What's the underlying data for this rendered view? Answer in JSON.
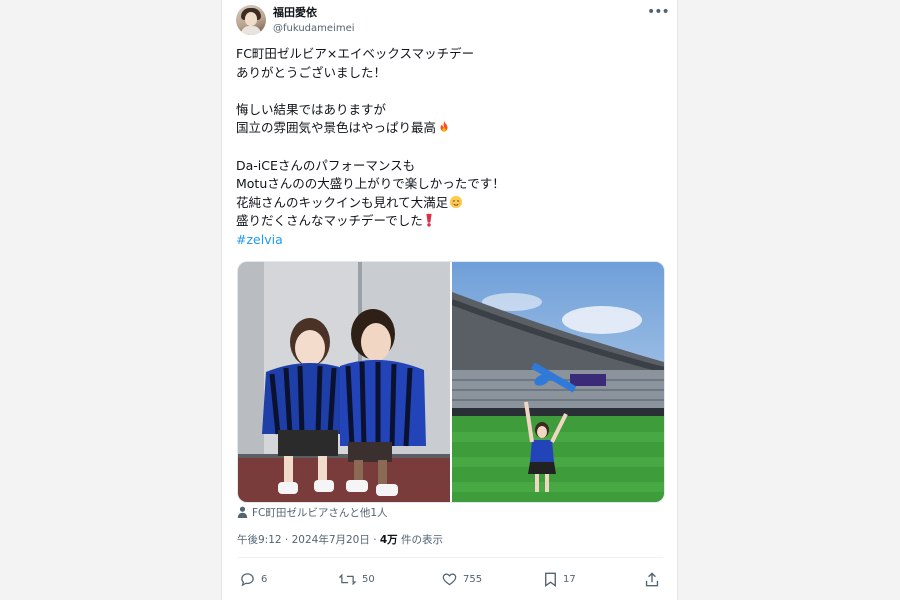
{
  "post": {
    "author_name": "福田愛依",
    "author_handle": "@fukudameimei",
    "more_label": "•••",
    "lines": [
      "FC町田ゼルビア×エイベックスマッチデー",
      "ありがとうございました！",
      "",
      "悔しい結果ではありますが",
      "国立の雰囲気や景色はやっぱり最高",
      "",
      "Da-iCEさんのパフォーマンスも",
      "Motuさんのの大盛り上がりで楽しかったです！",
      "花純さんのキックインも見れて大満足",
      "盛りだくさんなマッチデーでした"
    ],
    "hashtag": "#zelvia",
    "tagged": "FC町田ゼルビアさんと他1人",
    "timestamp": "午後9:12 · 2024年7月20日 · ",
    "views_count": "4万",
    "views_label": " 件の表示",
    "actions": {
      "replies": "6",
      "reposts": "50",
      "likes": "755",
      "bookmarks": "17"
    },
    "colors": {
      "hashtag": "#1d9bf0",
      "secondary_text": "#536471"
    }
  }
}
